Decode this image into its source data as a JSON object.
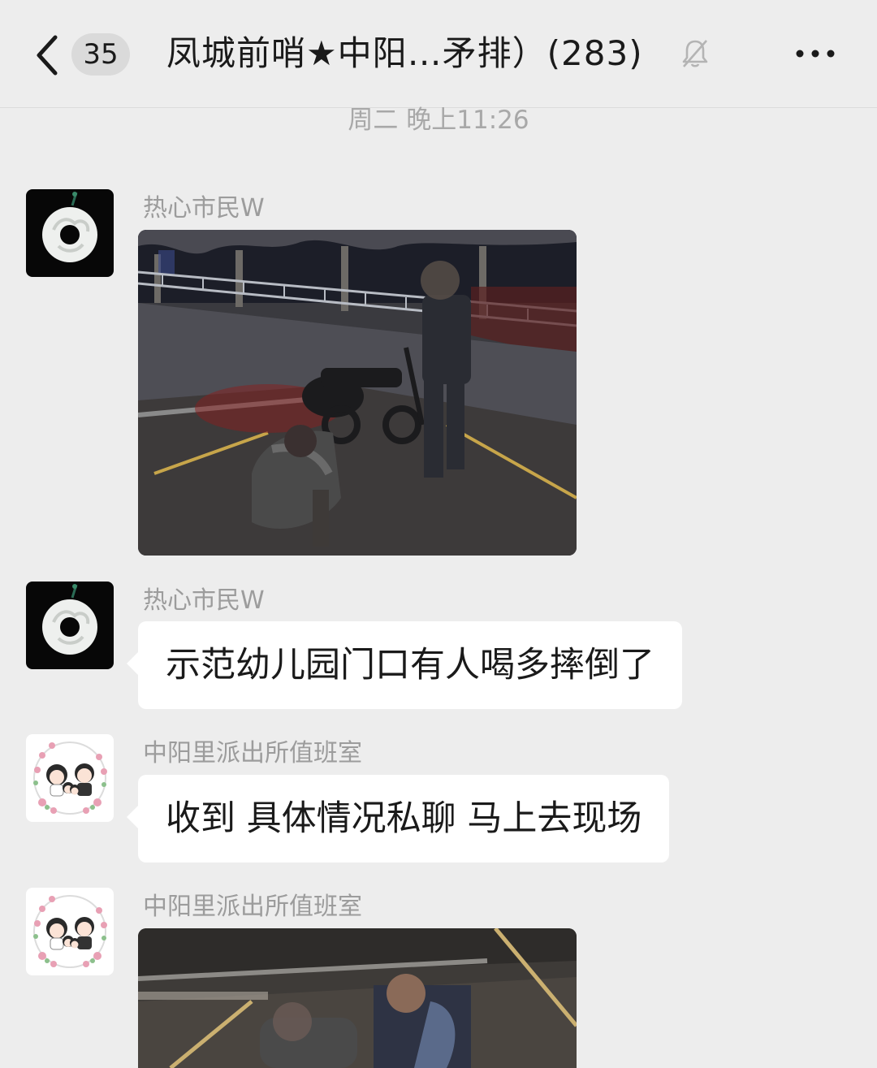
{
  "header": {
    "back_icon": "chevron-left-icon",
    "unread_count": "35",
    "title": "凤城前哨★中阳…矛排）(283)",
    "mute_icon": "bell-muted-icon",
    "more_icon": "ellipsis-icon"
  },
  "timestamp": "周二 晚上11:26",
  "messages": [
    {
      "sender": "热心市民W",
      "avatar": "jade-pendant-avatar",
      "type": "image",
      "image_alt": "Night street: a man fallen on the road beside an electric bike, another man standing"
    },
    {
      "sender": "热心市民W",
      "avatar": "jade-pendant-avatar",
      "type": "text",
      "text": "示范幼儿园门口有人喝多摔倒了"
    },
    {
      "sender": "中阳里派出所值班室",
      "avatar": "family-cartoon-avatar",
      "type": "text",
      "text": "收到 具体情况私聊  马上去现场"
    },
    {
      "sender": "中阳里派出所值班室",
      "avatar": "family-cartoon-avatar",
      "type": "image",
      "image_alt": "Night street: officer crouching beside the person on the ground"
    }
  ],
  "colors": {
    "background": "#ededed",
    "bubble": "#ffffff",
    "sender_text": "#9c9c9c",
    "timestamp_text": "#a8a8a8"
  }
}
